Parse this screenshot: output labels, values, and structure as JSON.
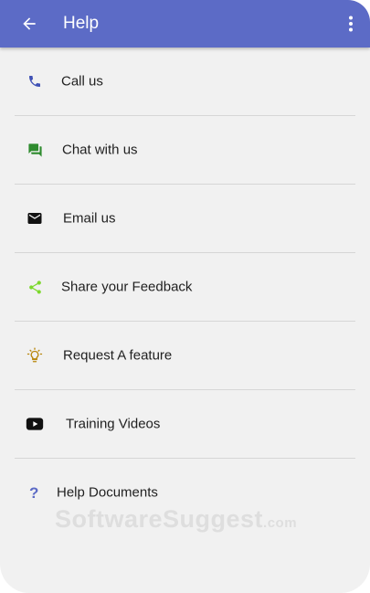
{
  "header": {
    "title": "Help",
    "back_icon": "arrow-back-icon",
    "menu_icon": "more-vertical-icon",
    "bg_color": "#5c6bc6"
  },
  "items": [
    {
      "label": "Call us",
      "icon": "phone-icon",
      "color": "#3f51b5"
    },
    {
      "label": "Chat with us",
      "icon": "chat-icon",
      "color": "#2e8b2e"
    },
    {
      "label": "Email us",
      "icon": "mail-icon",
      "color": "#111111"
    },
    {
      "label": "Share your Feedback",
      "icon": "share-icon",
      "color": "#7cd82c"
    },
    {
      "label": "Request A feature",
      "icon": "lightbulb-icon",
      "color": "#b8860b"
    },
    {
      "label": "Training Videos",
      "icon": "youtube-icon",
      "color": "#111111"
    },
    {
      "label": "Help Documents",
      "icon": "help-icon",
      "color": "#5c6bc6"
    }
  ],
  "watermark": {
    "text": "SoftwareSuggest",
    "suffix": ".com"
  }
}
